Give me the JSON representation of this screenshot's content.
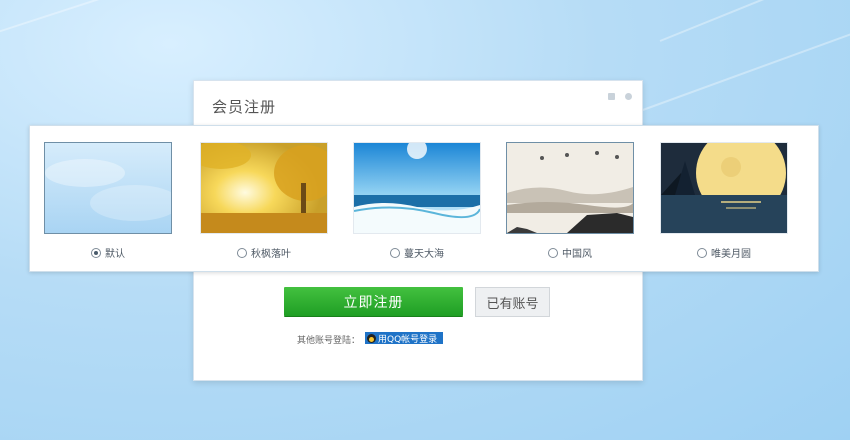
{
  "dialog": {
    "title": "会员注册",
    "icons": [
      "shirt-icon",
      "gear-icon"
    ]
  },
  "skins": [
    {
      "label": "默认",
      "selected": true
    },
    {
      "label": "秋枫落叶",
      "selected": false
    },
    {
      "label": "蔓天大海",
      "selected": false
    },
    {
      "label": "中国风",
      "selected": false
    },
    {
      "label": "唯美月圆",
      "selected": false
    }
  ],
  "actions": {
    "register_label": "立即注册",
    "login_label": "已有账号"
  },
  "other_login": {
    "label": "其他账号登陆：",
    "qq_label": "用QQ帐号登录"
  },
  "colors": {
    "register_button": "#2ea82f",
    "qq_button": "#1f73c7",
    "background": "#b6dcf6"
  }
}
